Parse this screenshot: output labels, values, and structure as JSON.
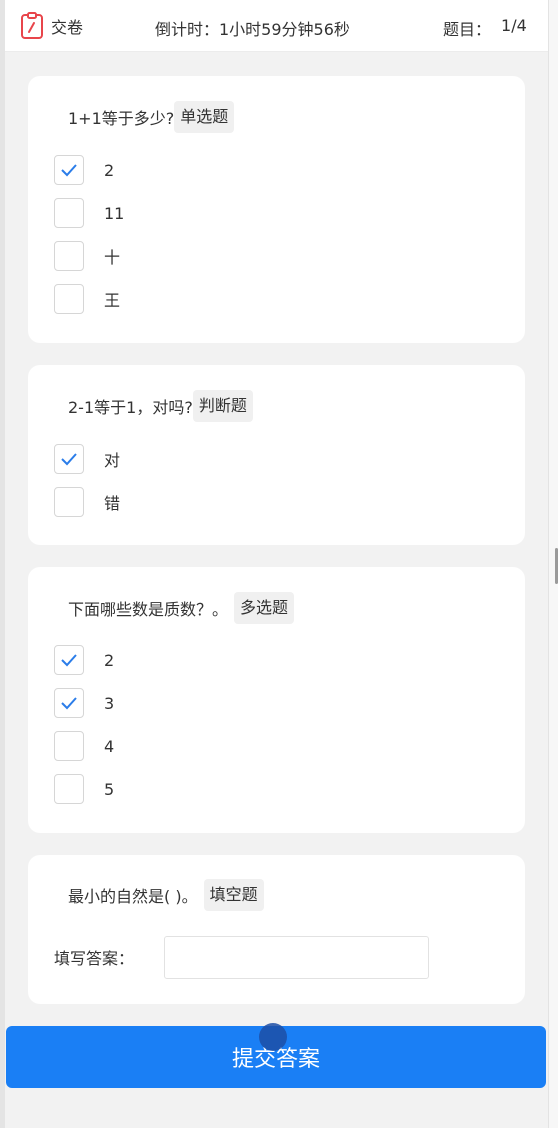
{
  "header": {
    "submit_label": "交卷",
    "countdown": "倒计时：1小时59分钟56秒",
    "progress_label": "题目：",
    "progress_value": "1/4"
  },
  "questions": [
    {
      "title": "1+1等于多少?",
      "type": "单选题",
      "options": [
        {
          "label": "2",
          "checked": true
        },
        {
          "label": "11",
          "checked": false
        },
        {
          "label": "十",
          "checked": false
        },
        {
          "label": "王",
          "checked": false
        }
      ]
    },
    {
      "title": "2-1等于1，对吗?",
      "type": "判断题",
      "options": [
        {
          "label": "对",
          "checked": true
        },
        {
          "label": "错",
          "checked": false
        }
      ]
    },
    {
      "title": "下面哪些数是质数？。",
      "type": "多选题",
      "options": [
        {
          "label": "2",
          "checked": true
        },
        {
          "label": "3",
          "checked": true
        },
        {
          "label": "4",
          "checked": false
        },
        {
          "label": "5",
          "checked": false
        }
      ]
    },
    {
      "title": "最小的自然是( )。",
      "type": "填空题",
      "fill_label": "填写答案：",
      "fill_value": "",
      "fill_placeholder": ""
    }
  ],
  "submit_button": "提交答案",
  "colors": {
    "accent": "#1a7ff5",
    "check": "#2b7de9",
    "icon": "#e8454b"
  }
}
